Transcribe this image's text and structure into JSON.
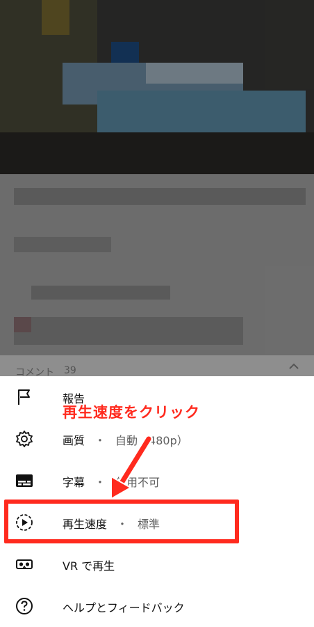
{
  "comments_peek": {
    "label": "コメント",
    "count": "39"
  },
  "menu": {
    "items": [
      {
        "key": "report",
        "icon": "flag-icon",
        "label": "報告",
        "sep": "",
        "value": ""
      },
      {
        "key": "quality",
        "icon": "gear-icon",
        "label": "画質",
        "sep": "・",
        "value": "自動（480p）"
      },
      {
        "key": "captions",
        "icon": "subtitles-icon",
        "label": "字幕",
        "sep": "・",
        "value": "使用不可"
      },
      {
        "key": "speed",
        "icon": "playback-speed-icon",
        "label": "再生速度",
        "sep": "・",
        "value": "標準"
      },
      {
        "key": "vr",
        "icon": "vr-headset-icon",
        "label": "VR で再生",
        "sep": "",
        "value": ""
      },
      {
        "key": "help",
        "icon": "help-circle-icon",
        "label": "ヘルプとフィードバック",
        "sep": "",
        "value": ""
      }
    ]
  },
  "annotation": {
    "callout": "再生速度をクリック",
    "color": "#ff2a1e"
  }
}
